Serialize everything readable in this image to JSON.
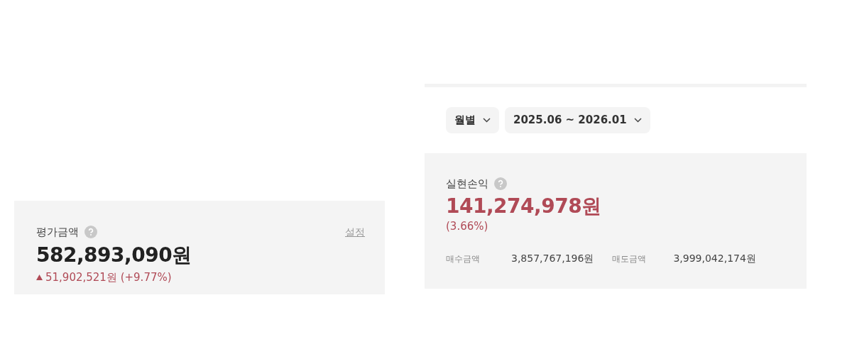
{
  "valuation": {
    "label": "평가금액",
    "settings_link": "설정",
    "amount": "582,893,090원",
    "change": "51,902,521원 (+9.77%)",
    "rising": true
  },
  "filters": [
    {
      "label": "월별"
    },
    {
      "label": "2025.06 ~ 2026.01"
    }
  ],
  "realized": {
    "label": "실현손익",
    "amount": "141,274,978원",
    "rate": "(3.66%)",
    "rising": true,
    "details": [
      {
        "label": "매수금액",
        "value": "3,857,767,196원"
      },
      {
        "label": "매도금액",
        "value": "3,999,042,174원"
      }
    ]
  }
}
